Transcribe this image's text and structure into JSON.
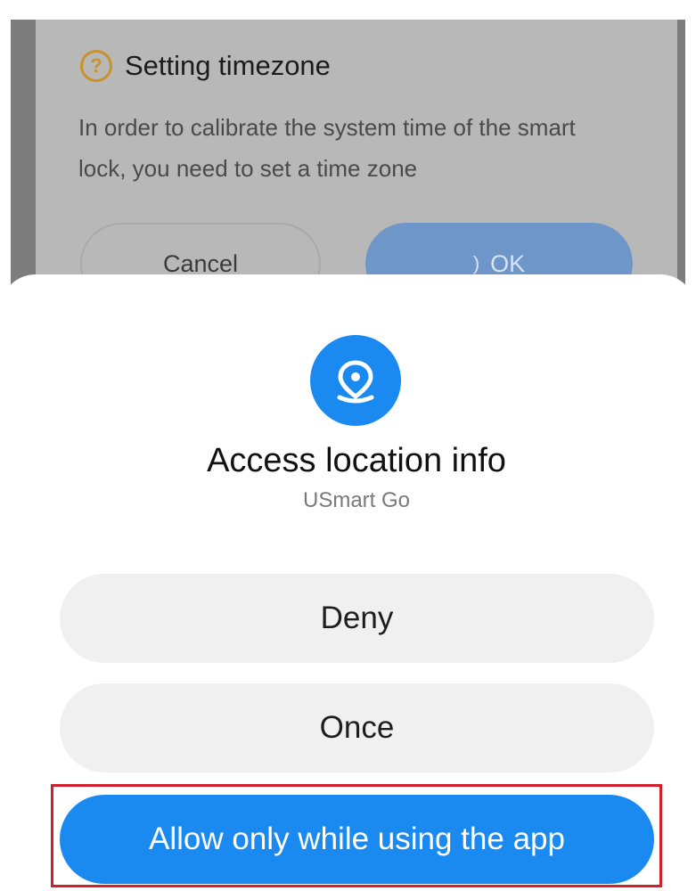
{
  "timezone_dialog": {
    "title": "Setting timezone",
    "icon": "question-circle-icon",
    "message": "In order to calibrate the system time of the smart lock, you need to set a time zone",
    "cancel_label": "Cancel",
    "ok_label": "OK",
    "ok_loading": true
  },
  "permission_sheet": {
    "icon": "location-pin-icon",
    "title": "Access location info",
    "app_name": "USmart Go",
    "buttons": {
      "deny": "Deny",
      "once": "Once",
      "allow": "Allow only while using the app"
    }
  },
  "colors": {
    "accent": "#1b8af0",
    "warning_icon": "#c9922a",
    "highlight_border": "#d0202e"
  }
}
